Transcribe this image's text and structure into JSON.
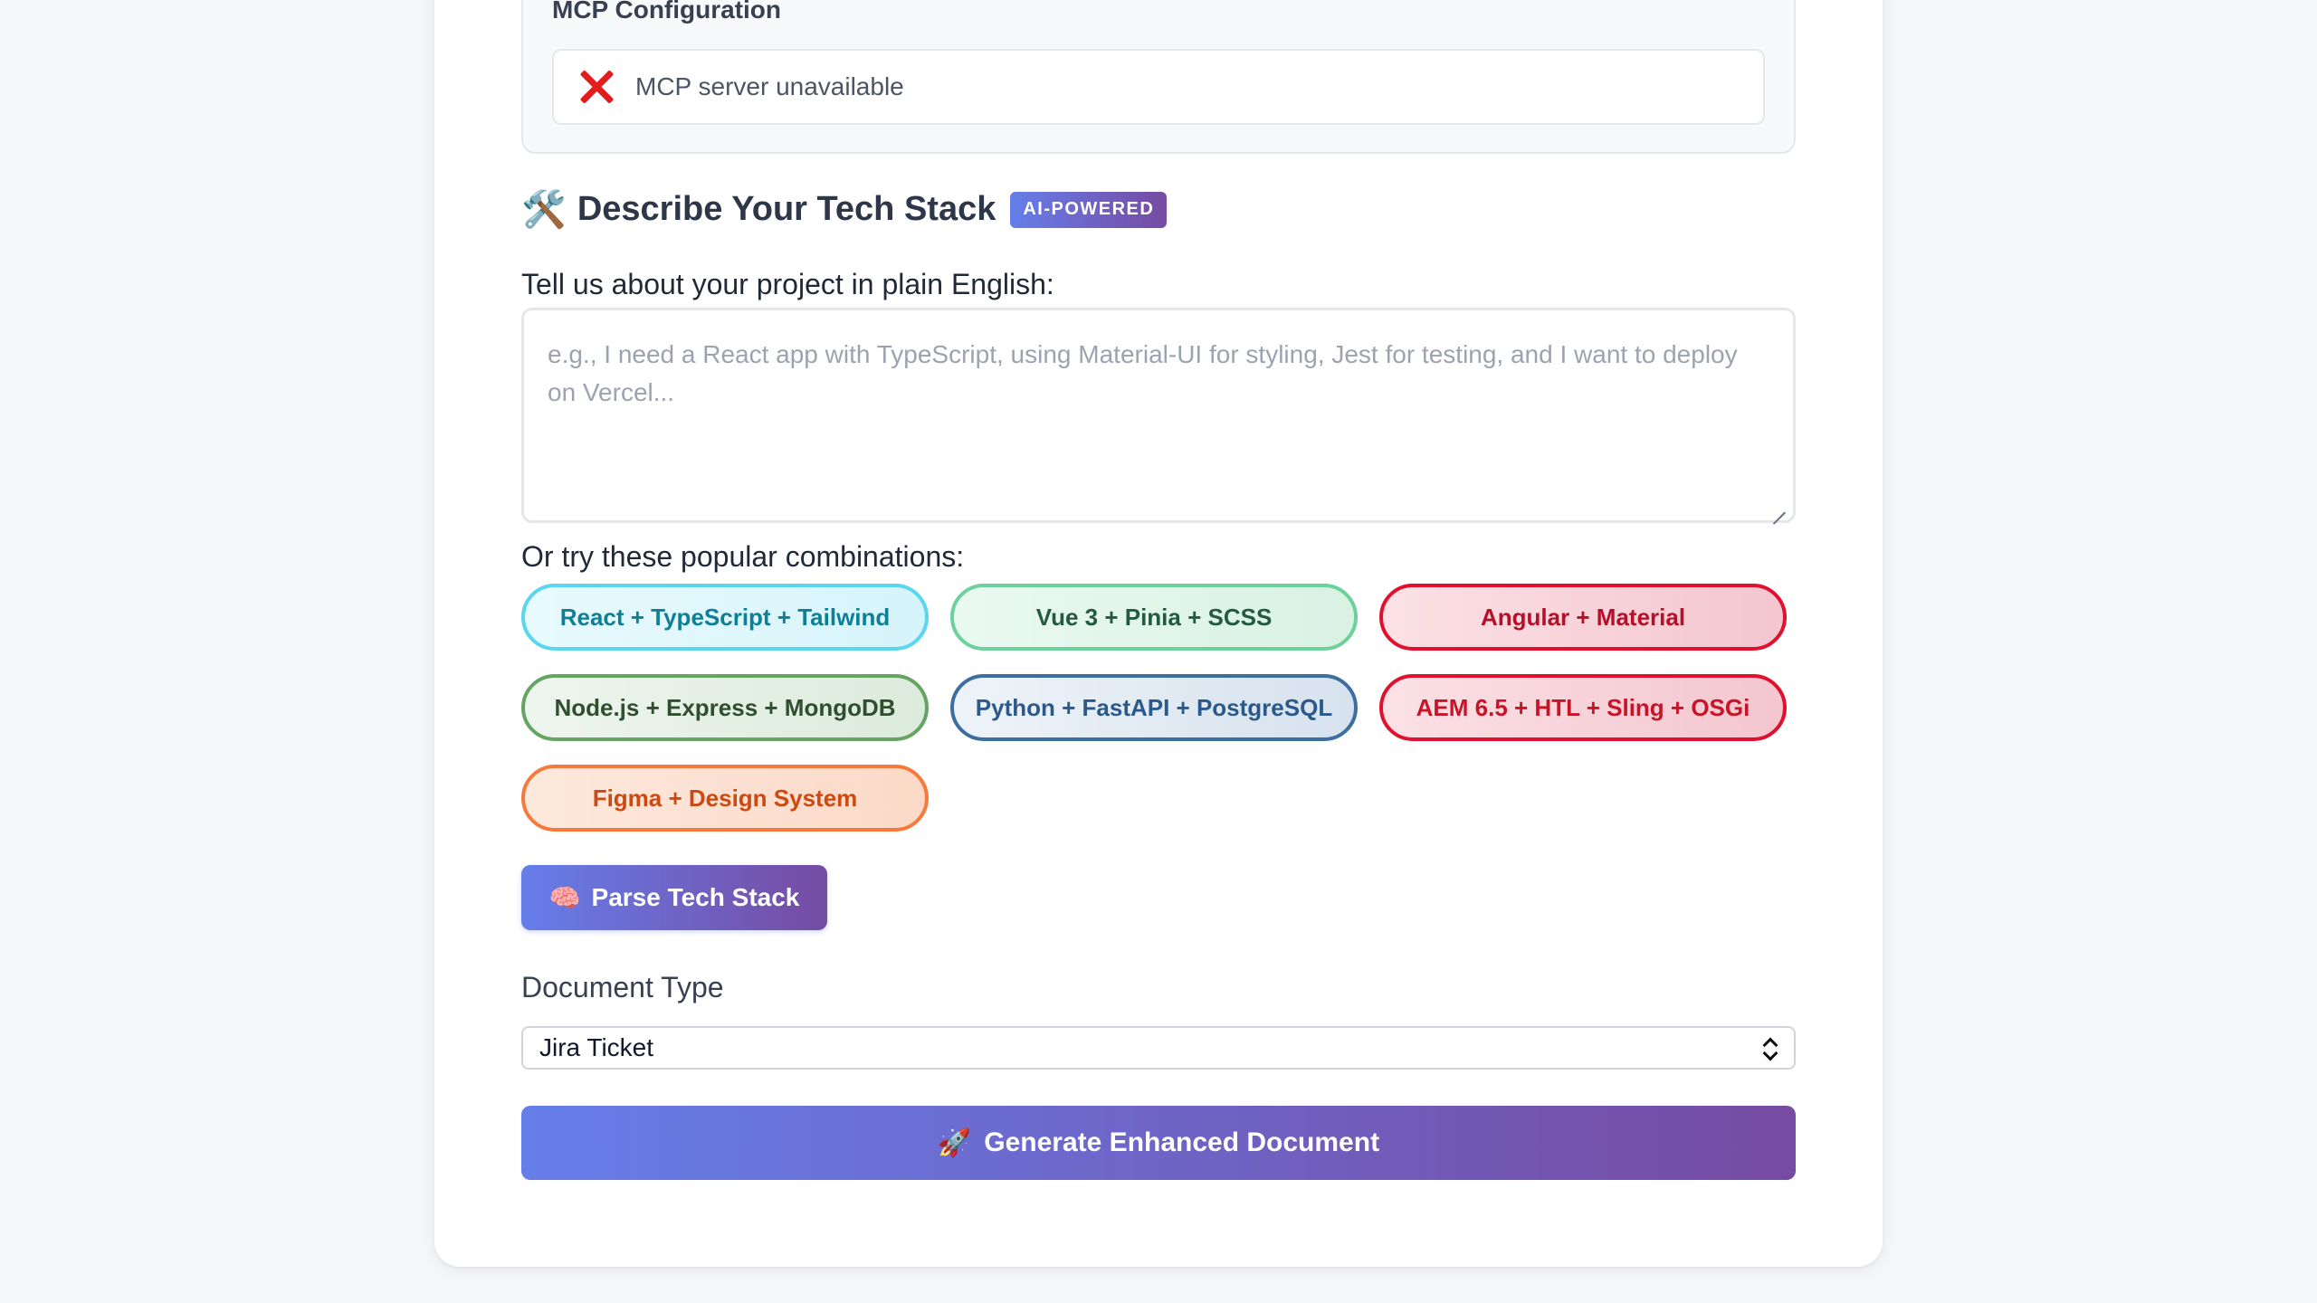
{
  "mcp": {
    "title": "MCP Configuration",
    "status_text": "MCP server unavailable",
    "status_icon": "error-x-icon",
    "status_color": "#e11d1d"
  },
  "tech_stack": {
    "icon": "🛠️",
    "title": "Describe Your Tech Stack",
    "badge": "AI-POWERED",
    "prompt_label": "Tell us about your project in plain English:",
    "textarea_value": "",
    "textarea_placeholder": "e.g., I need a React app with TypeScript, using Material-UI for styling, Jest for testing, and I want to deploy on Vercel...",
    "combinations_label": "Or try these popular combinations:",
    "combinations": [
      "React + TypeScript + Tailwind",
      "Vue 3 + Pinia + SCSS",
      "Angular + Material",
      "Node.js + Express + MongoDB",
      "Python + FastAPI + PostgreSQL",
      "AEM 6.5 + HTL + Sling + OSGi",
      "Figma + Design System"
    ],
    "parse_button": {
      "emoji": "🧠",
      "label": "Parse Tech Stack"
    }
  },
  "document": {
    "label": "Document Type",
    "selected": "Jira Ticket"
  },
  "generate_button": {
    "emoji": "🚀",
    "label": "Generate Enhanced Document"
  },
  "colors": {
    "accent_start": "#667eea",
    "accent_end": "#764ba2"
  }
}
